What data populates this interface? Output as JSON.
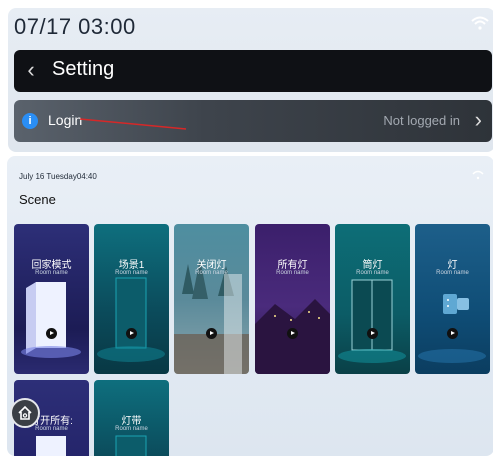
{
  "status_bar": {
    "time": "07/17 03:00",
    "wifi_icon": "wifi-icon"
  },
  "header": {
    "title": "Setting",
    "back_icon": "chevron-left-icon"
  },
  "login_row": {
    "label": "Login",
    "status": "Not logged in",
    "icon": "info-icon"
  },
  "scene_panel": {
    "date": "July 16 Tuesday04:40",
    "title": "Scene",
    "cards": [
      {
        "title": "回家模式",
        "subtitle": "Room name"
      },
      {
        "title": "场景1",
        "subtitle": "Room name"
      },
      {
        "title": "关闭灯",
        "subtitle": "Room name"
      },
      {
        "title": "所有灯",
        "subtitle": "Room name"
      },
      {
        "title": "筒灯",
        "subtitle": "Room name"
      },
      {
        "title": "灯",
        "subtitle": "Room name"
      },
      {
        "title": "打开所有:",
        "subtitle": "Room name"
      },
      {
        "title": "灯带",
        "subtitle": "Room name"
      }
    ]
  },
  "colors": {
    "accent_blue": "#2a8ef5",
    "header_bg": "#0f1115",
    "annotation_red": "#d62828"
  }
}
